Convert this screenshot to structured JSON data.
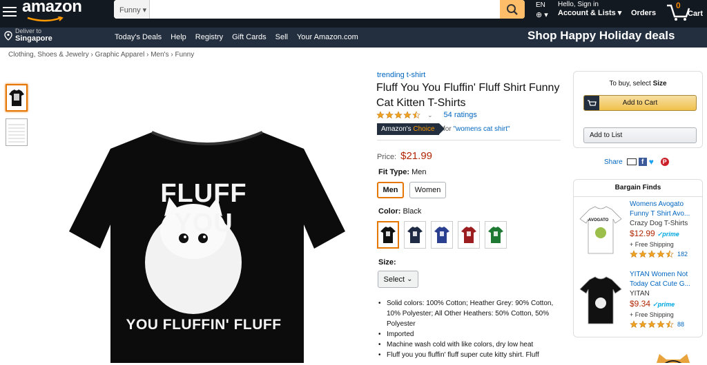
{
  "header": {
    "logo": "amazon",
    "search_category": "Funny",
    "search_value": "",
    "lang": "EN",
    "hello": "Hello, Sign in",
    "account": "Account & Lists",
    "orders": "Orders",
    "cart_count": "0",
    "cart_label": "Cart"
  },
  "nav": {
    "deliver_to": "Deliver to",
    "location": "Singapore",
    "links": [
      "Today's Deals",
      "Help",
      "Registry",
      "Gift Cards",
      "Sell",
      "Your Amazon.com"
    ],
    "promo": "Shop Happy Holiday deals"
  },
  "breadcrumbs": "Clothing, Shoes & Jewelry › Graphic Apparel › Men's › Funny",
  "product": {
    "shirt_line1": "FLUFF YOU",
    "shirt_line2": "YOU FLUFFIN' FLUFF",
    "brand_link": "trending t-shirt",
    "title": "Fluff You You Fluffin' Fluff Shirt Funny Cat Kitten T-Shirts",
    "rating": 4.5,
    "ratings_count": "54 ratings",
    "badge_a": "Amazon's ",
    "badge_b": "Choice",
    "badge_for": "for",
    "badge_query": "\"womens cat shirt\"",
    "price_label": "Price:",
    "price": "$21.99",
    "fit_label": "Fit Type:",
    "fit_value": "Men",
    "fit_options": [
      "Men",
      "Women"
    ],
    "color_label": "Color:",
    "color_value": "Black",
    "colors": [
      "#111111",
      "#1f2a44",
      "#2a3f8f",
      "#9b1d20",
      "#1e7a33"
    ],
    "size_label": "Size:",
    "size_select": "Select",
    "bullets": [
      "Solid colors: 100% Cotton; Heather Grey: 90% Cotton, 10% Polyester; All Other Heathers: 50% Cotton, 50% Polyester",
      "Imported",
      "Machine wash cold with like colors, dry low heat",
      "Fluff you you fluffin' fluff super cute kitty shirt. Fluff"
    ]
  },
  "buybox": {
    "select_a": "To buy, select ",
    "select_b": "Size",
    "add_to_cart": "Add to Cart",
    "add_to_list": "Add to List",
    "share": "Share"
  },
  "bargain": {
    "heading": "Bargain Finds",
    "items": [
      {
        "title": "Womens Avogato Funny T Shirt Avo...",
        "seller": "Crazy Dog T-Shirts",
        "price": "$12.99",
        "prime": "prime",
        "shipping": "+ Free Shipping",
        "reviews": "182",
        "shirt_text": "AVOGATO",
        "color": "#ffffff"
      },
      {
        "title": "YITAN Women Not Today Cat Cute G...",
        "seller": "YITAN",
        "price": "$9.34",
        "prime": "prime",
        "shipping": "+ Free Shipping",
        "reviews": "88",
        "shirt_text": "",
        "color": "#111111"
      }
    ]
  }
}
